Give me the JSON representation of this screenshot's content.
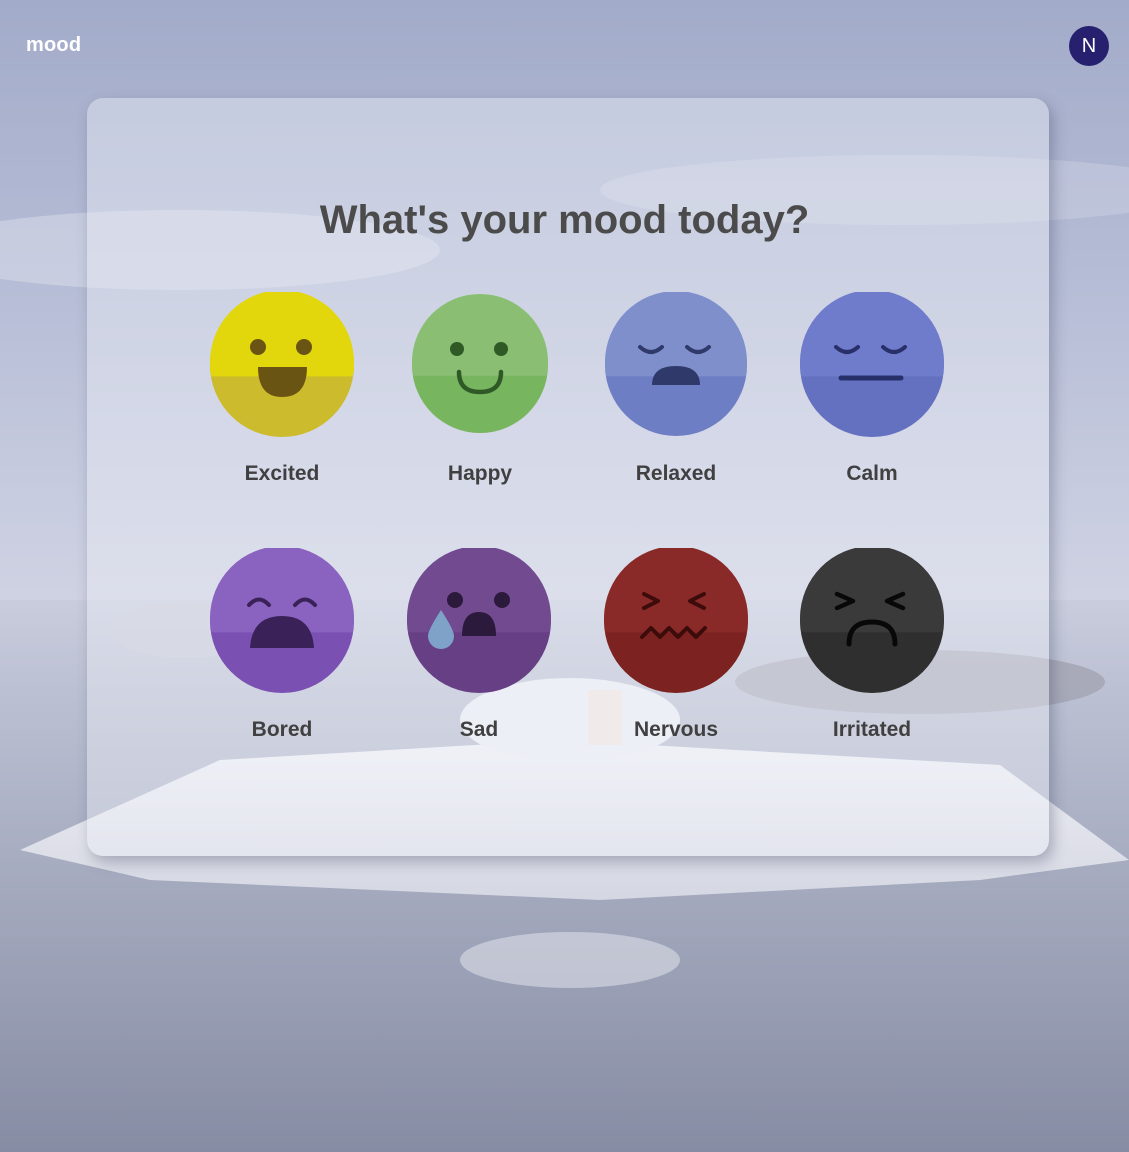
{
  "app": {
    "brand": "mood",
    "user_initial": "N"
  },
  "prompt": {
    "title": "What's your mood today?"
  },
  "moods": [
    {
      "label": "Excited",
      "icon": "excited-face-icon",
      "color": "#e2d60c",
      "shade": "#cdbb2e"
    },
    {
      "label": "Happy",
      "icon": "happy-face-icon",
      "color": "#8abf73",
      "shade": "#78b55f"
    },
    {
      "label": "Relaxed",
      "icon": "relaxed-face-icon",
      "color": "#7f8fcc",
      "shade": "#6e7ec4"
    },
    {
      "label": "Calm",
      "icon": "calm-face-icon",
      "color": "#6f7bcb",
      "shade": "#6470c0"
    },
    {
      "label": "Bored",
      "icon": "bored-face-icon",
      "color": "#8a62bf",
      "shade": "#7a50b3"
    },
    {
      "label": "Sad",
      "icon": "sad-face-icon",
      "color": "#724a90",
      "shade": "#673f85"
    },
    {
      "label": "Nervous",
      "icon": "nervous-face-icon",
      "color": "#8a2a28",
      "shade": "#7c2220"
    },
    {
      "label": "Irritated",
      "icon": "irritated-face-icon",
      "color": "#3a3a3a",
      "shade": "#2f2f2f"
    }
  ],
  "theme": {
    "avatar_bg": "#26206e",
    "title_color": "#4b4b4b",
    "label_color": "#404040"
  }
}
